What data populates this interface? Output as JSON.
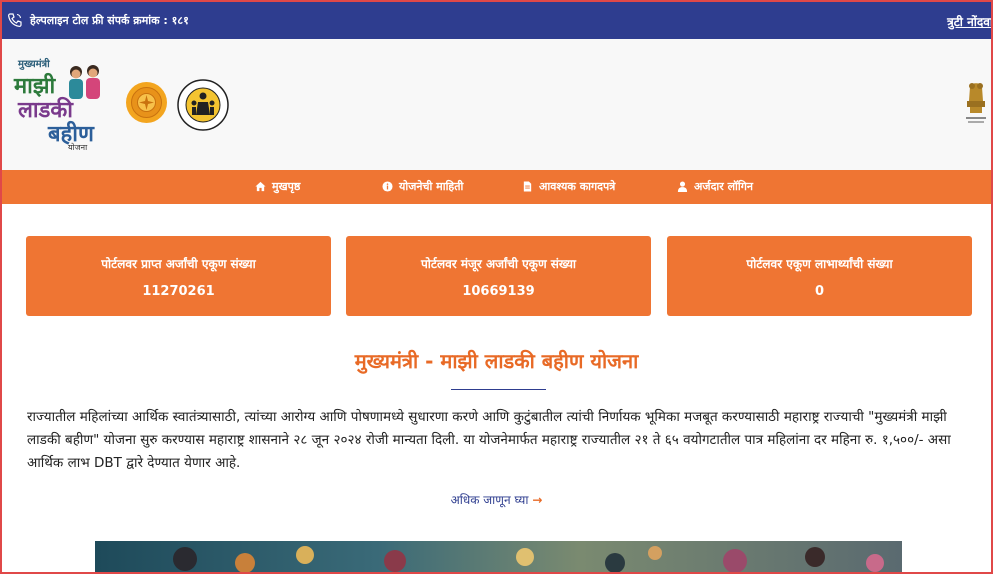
{
  "topbar": {
    "helpline": "हेल्पलाइन टोल फ्री संपर्क क्रमांक : १८१",
    "report_link": "त्रुटी नोंदवा"
  },
  "header": {
    "logo": {
      "top": "मुख्यमंत्री",
      "line1": "माझी",
      "line2": "लाडकी",
      "line3": "बहीण",
      "line4": "योजना"
    }
  },
  "nav": {
    "items": [
      {
        "label": "मुखपृष्ठ",
        "icon": "home-icon"
      },
      {
        "label": "योजनेची माहिती",
        "icon": "info-icon"
      },
      {
        "label": "आवश्यक कागदपत्रे",
        "icon": "document-icon"
      },
      {
        "label": "अर्जदार लॉगिन",
        "icon": "user-icon"
      }
    ]
  },
  "stats": [
    {
      "label": "पोर्टलवर प्राप्त अर्जांची एकूण संख्या",
      "value": "11270261"
    },
    {
      "label": "पोर्टलवर मंजूर अर्जांची एकूण संख्या",
      "value": "10669139"
    },
    {
      "label": "पोर्टलवर एकूण लाभार्थ्यांची संख्या",
      "value": "0"
    }
  ],
  "main": {
    "title": "मुख्यमंत्री - माझी लाडकी बहीण योजना",
    "description": "राज्यातील महिलांच्या आर्थिक स्वातंत्र्यासाठी, त्यांच्या आरोग्य आणि पोषणामध्ये सुधारणा करणे आणि कुटुंबातील त्यांची निर्णायक भूमिका मजबूत करण्यासाठी महाराष्ट्र राज्याची \"मुख्यमंत्री माझी लाडकी बहीण\" योजना सुरु करण्यास महाराष्ट्र शासनाने २८ जून २०२४ रोजी मान्यता दिली. या योजनेमार्फत महाराष्ट्र राज्यातील २१ ते ६५ वयोगटातील पात्र महिलांना दर महिना रु. १,५००/- असा आर्थिक लाभ DBT द्वारे देण्यात येणार आहे.",
    "more_link": "अधिक जाणून घ्या",
    "more_arrow": "→"
  },
  "colors": {
    "topbar": "#2e3d8f",
    "accent": "#ef7533",
    "title": "#e86a26"
  }
}
